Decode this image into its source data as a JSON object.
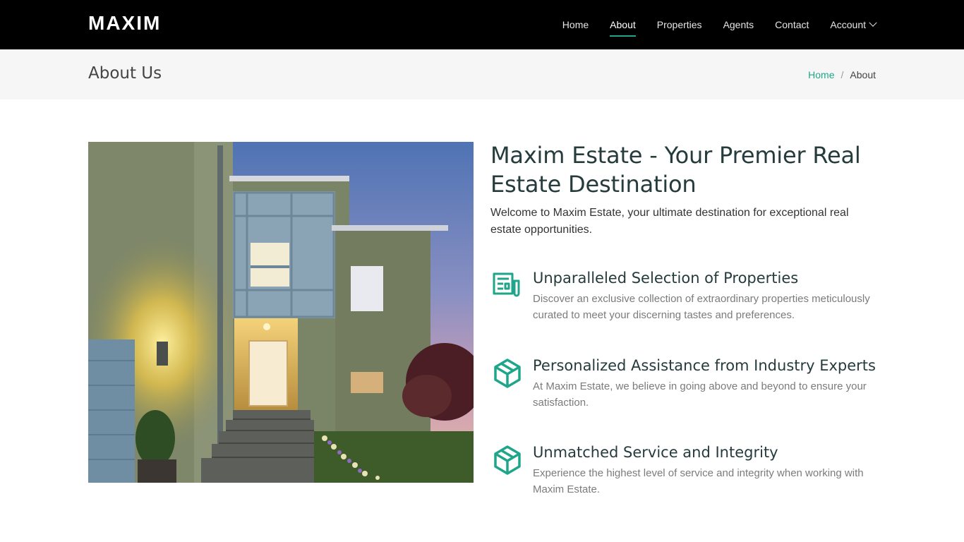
{
  "brand": {
    "name": "MAXIM"
  },
  "nav": {
    "items": [
      {
        "label": "Home"
      },
      {
        "label": "About"
      },
      {
        "label": "Properties"
      },
      {
        "label": "Agents"
      },
      {
        "label": "Contact"
      },
      {
        "label": "Account"
      }
    ],
    "active": "About",
    "accent_color": "#1fa68a"
  },
  "banner": {
    "title": "About Us",
    "breadcrumb": {
      "home": "Home",
      "separator": "/",
      "current": "About"
    }
  },
  "about": {
    "heading": "Maxim Estate - Your Premier Real Estate Destination",
    "intro": "Welcome to Maxim Estate, your ultimate destination for exceptional real estate opportunities.",
    "features": [
      {
        "icon": "newspaper-icon",
        "title": "Unparalleled Selection of Properties",
        "text": "Discover an exclusive collection of extraordinary properties meticulously curated to meet your discerning tastes and preferences."
      },
      {
        "icon": "cube-icon",
        "title": "Personalized Assistance from Industry Experts",
        "text": "At Maxim Estate, we believe in going above and beyond to ensure your satisfaction."
      },
      {
        "icon": "cube-icon",
        "title": "Unmatched Service and Integrity",
        "text": "Experience the highest level of service and integrity when working with Maxim Estate."
      }
    ]
  }
}
